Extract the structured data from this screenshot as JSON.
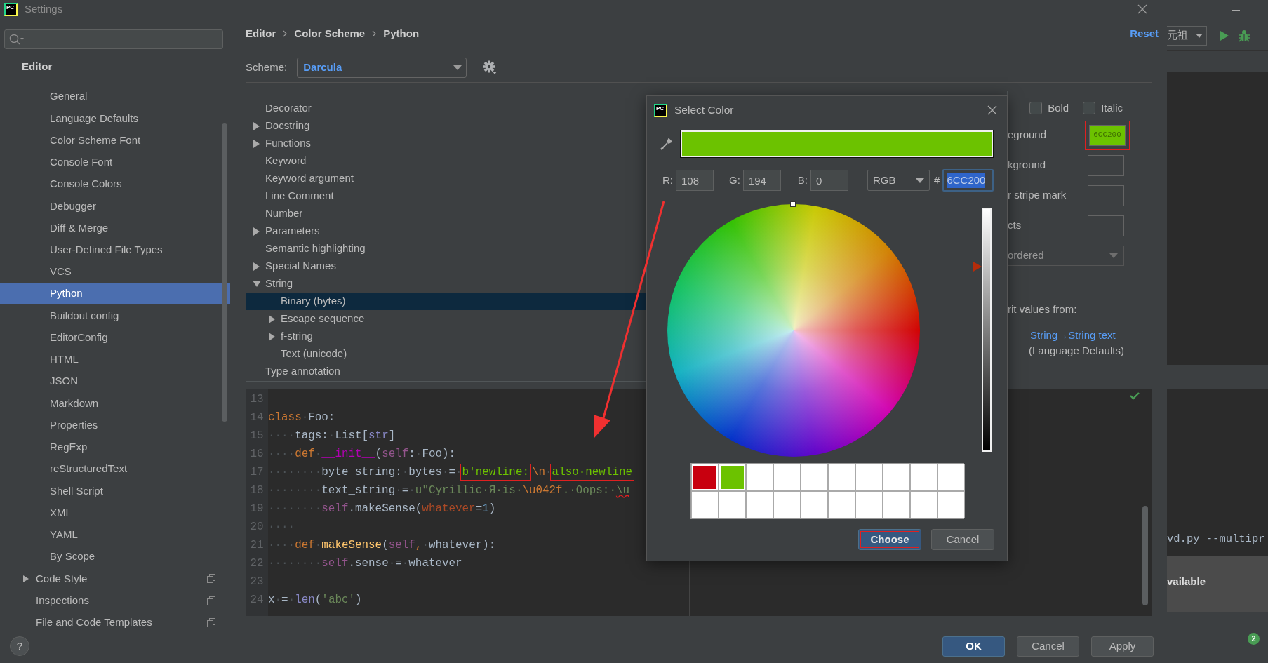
{
  "window": {
    "logo": "PC",
    "title": "Settings"
  },
  "sidebar": {
    "header": "Editor",
    "items": [
      {
        "children": [
          {
            "label": "General",
            "selected": false
          },
          {
            "label": "Language Defaults",
            "selected": false
          },
          {
            "label": "Color Scheme Font",
            "selected": false
          },
          {
            "label": "Console Font",
            "selected": false
          },
          {
            "label": "Console Colors",
            "selected": false
          },
          {
            "label": "Debugger",
            "selected": false
          },
          {
            "label": "Diff & Merge",
            "selected": false
          },
          {
            "label": "User-Defined File Types",
            "selected": false
          },
          {
            "label": "VCS",
            "selected": false
          },
          {
            "label": "Python",
            "selected": true
          },
          {
            "label": "Buildout config",
            "selected": false
          },
          {
            "label": "EditorConfig",
            "selected": false
          },
          {
            "label": "HTML",
            "selected": false
          },
          {
            "label": "JSON",
            "selected": false
          },
          {
            "label": "Markdown",
            "selected": false
          },
          {
            "label": "Properties",
            "selected": false
          },
          {
            "label": "RegExp",
            "selected": false
          },
          {
            "label": "reStructuredText",
            "selected": false
          },
          {
            "label": "Shell Script",
            "selected": false
          },
          {
            "label": "XML",
            "selected": false
          },
          {
            "label": "YAML",
            "selected": false
          },
          {
            "label": "By Scope",
            "selected": false
          }
        ]
      },
      {
        "label": "Code Style",
        "selected": false,
        "expanded": false,
        "project_level": true
      },
      {
        "label": "Inspections",
        "selected": false,
        "project_level": true
      },
      {
        "label": "File and Code Templates",
        "selected": false,
        "project_level": true
      }
    ]
  },
  "breadcrumb": [
    "Editor",
    "Color Scheme",
    "Python"
  ],
  "reset_link": "Reset",
  "scheme": {
    "label": "Scheme:",
    "value": "Darcula"
  },
  "tree": {
    "items": [
      {
        "label": "Decorator",
        "selected": false
      },
      {
        "label": "Docstring",
        "selected": false,
        "expanded": false
      },
      {
        "label": "Functions",
        "selected": false,
        "expanded": false
      },
      {
        "label": "Keyword",
        "selected": false
      },
      {
        "label": "Keyword argument",
        "selected": false
      },
      {
        "label": "Line Comment",
        "selected": false
      },
      {
        "label": "Number",
        "selected": false
      },
      {
        "label": "Parameters",
        "selected": false,
        "expanded": false
      },
      {
        "label": "Semantic highlighting",
        "selected": false
      },
      {
        "label": "Special Names",
        "selected": false,
        "expanded": false
      },
      {
        "label": "String",
        "selected": false,
        "expanded": true,
        "children": [
          {
            "label": "Binary (bytes)",
            "selected": true
          },
          {
            "label": "Escape sequence",
            "selected": false,
            "expanded": false
          },
          {
            "label": "f-string",
            "selected": false,
            "expanded": false
          },
          {
            "label": "Text (unicode)",
            "selected": false
          }
        ]
      },
      {
        "label": "Type annotation",
        "selected": false
      }
    ]
  },
  "options": {
    "checkboxes": [
      {
        "label": "Bold",
        "checked": false
      },
      {
        "label": "Italic",
        "checked": false
      }
    ],
    "rows": [
      {
        "kind": "swatch",
        "label": "eground",
        "color": "#6cc200",
        "value": "6CC200",
        "highlighted": true
      },
      {
        "kind": "swatch",
        "label": "kground"
      },
      {
        "kind": "swatch",
        "label": "r stripe mark"
      },
      {
        "kind": "swatch",
        "label": "cts"
      },
      {
        "kind": "dropdown",
        "label": "ordered"
      }
    ],
    "inherit_label": "rit values from:",
    "inherit_link": "String→String text",
    "inherit_source": "(Language Defaults)"
  },
  "preview": {
    "lines": [
      {
        "number": "13"
      },
      {
        "number": "14",
        "tokens": [
          {
            "text": "class",
            "kind": "keyword"
          },
          {
            "text": "·",
            "kind": "ws"
          },
          {
            "text": "Foo:",
            "kind": "plain"
          }
        ]
      },
      {
        "number": "15",
        "tokens": [
          {
            "text": "····",
            "kind": "ws"
          },
          {
            "text": "tags:",
            "kind": "plain"
          },
          {
            "text": "·",
            "kind": "ws"
          },
          {
            "text": "List[",
            "kind": "plain"
          },
          {
            "text": "str",
            "kind": "builtin"
          },
          {
            "text": "]",
            "kind": "plain"
          }
        ]
      },
      {
        "number": "16",
        "tokens": [
          {
            "text": "····",
            "kind": "ws"
          },
          {
            "text": "def",
            "kind": "keyword"
          },
          {
            "text": "·",
            "kind": "ws"
          },
          {
            "text": "__init__",
            "kind": "dunder"
          },
          {
            "text": "(",
            "kind": "plain"
          },
          {
            "text": "self",
            "kind": "self"
          },
          {
            "text": ":",
            "kind": "plain"
          },
          {
            "text": "·",
            "kind": "ws"
          },
          {
            "text": "Foo):",
            "kind": "plain"
          }
        ]
      },
      {
        "number": "17",
        "tokens": [
          {
            "text": "········",
            "kind": "ws"
          },
          {
            "text": "byte_string:",
            "kind": "plain"
          },
          {
            "text": "·",
            "kind": "ws"
          },
          {
            "text": "bytes",
            "kind": "plain"
          },
          {
            "text": "·",
            "kind": "ws"
          },
          {
            "text": "=",
            "kind": "plain"
          },
          {
            "text": "·",
            "kind": "ws"
          },
          {
            "text": "b'newline:",
            "kind": "bytes",
            "highlighted": true
          },
          {
            "text": "\\n",
            "kind": "escape"
          },
          {
            "text": "·",
            "kind": "ws"
          },
          {
            "text": "also·newline",
            "kind": "bytes",
            "highlighted": true
          }
        ]
      },
      {
        "number": "18",
        "tokens": [
          {
            "text": "········",
            "kind": "ws"
          },
          {
            "text": "text_string",
            "kind": "plain"
          },
          {
            "text": "·",
            "kind": "ws"
          },
          {
            "text": "=",
            "kind": "plain"
          },
          {
            "text": "·",
            "kind": "ws"
          },
          {
            "text": "u\"Cyrillic·Я·is·",
            "kind": "string"
          },
          {
            "text": "\\u042f",
            "kind": "escape"
          },
          {
            "text": ".·Oops:·",
            "kind": "string"
          },
          {
            "text": "\\u",
            "kind": "invalid"
          }
        ]
      },
      {
        "number": "19",
        "tokens": [
          {
            "text": "········",
            "kind": "ws"
          },
          {
            "text": "self",
            "kind": "self"
          },
          {
            "text": ".makeSense(",
            "kind": "plain"
          },
          {
            "text": "whatever",
            "kind": "param"
          },
          {
            "text": "=",
            "kind": "plain"
          },
          {
            "text": "1",
            "kind": "number"
          },
          {
            "text": ")",
            "kind": "plain"
          }
        ]
      },
      {
        "number": "20",
        "tokens": [
          {
            "text": "····",
            "kind": "ws"
          }
        ]
      },
      {
        "number": "21",
        "tokens": [
          {
            "text": "····",
            "kind": "ws"
          },
          {
            "text": "def",
            "kind": "keyword"
          },
          {
            "text": "·",
            "kind": "ws"
          },
          {
            "text": "makeSense",
            "kind": "func"
          },
          {
            "text": "(",
            "kind": "plain"
          },
          {
            "text": "self",
            "kind": "self"
          },
          {
            "text": ",",
            "kind": "keyword"
          },
          {
            "text": "·",
            "kind": "ws"
          },
          {
            "text": "whatever):",
            "kind": "plain"
          }
        ]
      },
      {
        "number": "22",
        "tokens": [
          {
            "text": "········",
            "kind": "ws"
          },
          {
            "text": "self",
            "kind": "self"
          },
          {
            "text": ".sense",
            "kind": "plain"
          },
          {
            "text": "·",
            "kind": "ws"
          },
          {
            "text": "=",
            "kind": "plain"
          },
          {
            "text": "·",
            "kind": "ws"
          },
          {
            "text": "whatever",
            "kind": "plain"
          }
        ]
      },
      {
        "number": "23"
      },
      {
        "number": "24",
        "tokens": [
          {
            "text": "x",
            "kind": "plain"
          },
          {
            "text": "·",
            "kind": "ws"
          },
          {
            "text": "=",
            "kind": "plain"
          },
          {
            "text": "·",
            "kind": "ws"
          },
          {
            "text": "len",
            "kind": "builtin"
          },
          {
            "text": "(",
            "kind": "plain"
          },
          {
            "text": "'abc'",
            "kind": "string"
          },
          {
            "text": ")",
            "kind": "plain"
          }
        ]
      }
    ]
  },
  "dialog": {
    "logo": "PC",
    "title": "Select Color",
    "preview": {
      "color": "#6cc200"
    },
    "fields": [
      {
        "label": "R:",
        "value": "108"
      },
      {
        "label": "G:",
        "value": "194"
      },
      {
        "label": "B:",
        "value": "0"
      }
    ],
    "mode": "RGB",
    "hash_label": "#",
    "hex": "6CC200",
    "brightness": {
      "level": 0.76
    },
    "recent_colors": [
      {
        "color": "#c8000f"
      },
      {
        "color": "#6cc200"
      }
    ],
    "buttons": [
      {
        "label": "Choose",
        "kind": "primary",
        "highlighted": true
      },
      {
        "label": "Cancel",
        "kind": "secondary",
        "highlighted": false
      }
    ]
  },
  "annotation_arrow": true,
  "footer": {
    "help": "?",
    "buttons": [
      {
        "label": "OK",
        "kind": "primary"
      },
      {
        "label": "Cancel",
        "kind": "secondary"
      },
      {
        "label": "Apply",
        "kind": "secondary"
      }
    ]
  },
  "ide": {
    "run_config": "元祖",
    "console_text": "vd.py --multipr",
    "notice": "vailable",
    "badge": "2"
  }
}
